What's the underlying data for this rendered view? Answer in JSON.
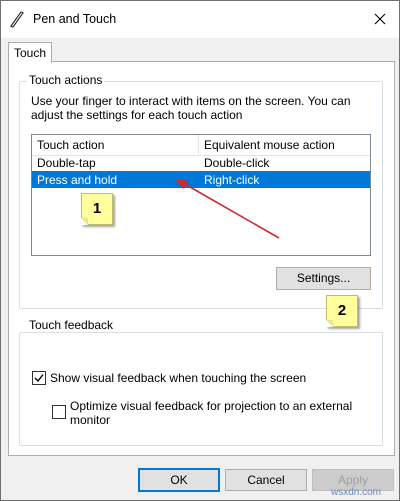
{
  "window": {
    "title": "Pen and Touch"
  },
  "tabs": [
    {
      "label": "Touch"
    }
  ],
  "touch_actions": {
    "group_title": "Touch actions",
    "description": "Use your finger to interact with items on the screen. You can adjust the settings for each touch action",
    "columns": [
      "Touch action",
      "Equivalent mouse action"
    ],
    "rows": [
      {
        "action": "Double-tap",
        "mouse": "Double-click",
        "selected": false
      },
      {
        "action": "Press and hold",
        "mouse": "Right-click",
        "selected": true
      }
    ],
    "settings_button": "Settings..."
  },
  "touch_feedback": {
    "group_title": "Touch feedback",
    "show_visual_feedback": {
      "label": "Show visual feedback when touching the screen",
      "checked": true
    },
    "optimize_feedback": {
      "label": "Optimize visual feedback for projection to an external monitor",
      "checked": false
    }
  },
  "footer": {
    "ok": "OK",
    "cancel": "Cancel",
    "apply": "Apply"
  },
  "annotations": {
    "callout_1": "1",
    "callout_2": "2",
    "arrow_color": "#cc2b2b"
  },
  "watermark": "wsxdn.com",
  "colors": {
    "selection": "#0078d7",
    "default_button_border": "#0078d7"
  }
}
